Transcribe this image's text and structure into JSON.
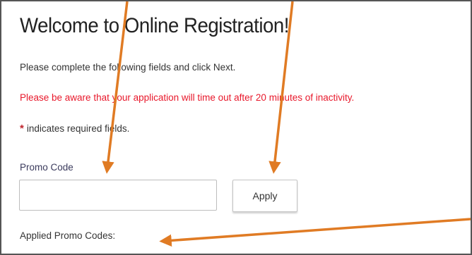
{
  "page": {
    "title": "Welcome to Online Registration!",
    "intro": "Please complete the following fields and click Next.",
    "timeout_warning": "Please be aware that your application will time out after 20 minutes of inactivity.",
    "required_symbol": "*",
    "required_note": "indicates required fields."
  },
  "promo": {
    "label": "Promo Code",
    "input_value": "",
    "input_placeholder": "",
    "apply_label": "Apply",
    "applied_label": "Applied Promo Codes:"
  },
  "colors": {
    "warning_text": "#e8182b",
    "required_star": "#c0262e",
    "annotation_arrow": "#e07b24"
  }
}
